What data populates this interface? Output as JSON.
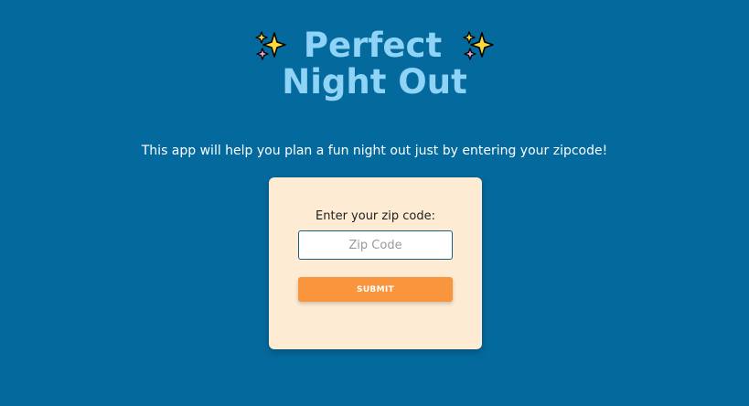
{
  "header": {
    "title_line1": "Perfect",
    "title_line2": "Night Out",
    "left_icon": "sparkles-icon",
    "right_icon": "sparkles-icon",
    "title_color": "#8fd3f7"
  },
  "intro": {
    "text": "This app will help you plan a fun night out just by entering your zipcode!"
  },
  "form": {
    "label": "Enter your zip code:",
    "input_value": "",
    "input_placeholder": "Zip Code",
    "submit_label": "SUBMIT"
  },
  "colors": {
    "background": "#046a9e",
    "card": "#fdebd3",
    "submit": "#f9953c",
    "input_border": "#1f5b7a"
  }
}
